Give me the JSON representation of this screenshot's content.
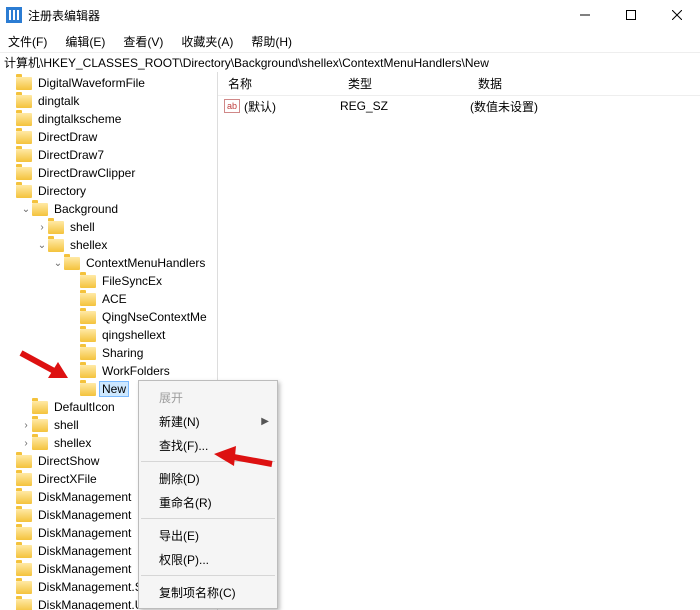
{
  "window": {
    "title": "注册表编辑器"
  },
  "menu": [
    "文件(F)",
    "编辑(E)",
    "查看(V)",
    "收藏夹(A)",
    "帮助(H)"
  ],
  "address": "计算机\\HKEY_CLASSES_ROOT\\Directory\\Background\\shellex\\ContextMenuHandlers\\New",
  "tree": [
    {
      "indent": 0,
      "chev": "",
      "label": "DigitalWaveformFile"
    },
    {
      "indent": 0,
      "chev": "",
      "label": "dingtalk"
    },
    {
      "indent": 0,
      "chev": "",
      "label": "dingtalkscheme"
    },
    {
      "indent": 0,
      "chev": "",
      "label": "DirectDraw"
    },
    {
      "indent": 0,
      "chev": "",
      "label": "DirectDraw7"
    },
    {
      "indent": 0,
      "chev": "",
      "label": "DirectDrawClipper"
    },
    {
      "indent": 0,
      "chev": "",
      "label": "Directory"
    },
    {
      "indent": 1,
      "chev": "open",
      "label": "Background"
    },
    {
      "indent": 2,
      "chev": "closed",
      "label": "shell"
    },
    {
      "indent": 2,
      "chev": "open",
      "label": "shellex"
    },
    {
      "indent": 3,
      "chev": "open",
      "label": "ContextMenuHandlers"
    },
    {
      "indent": 4,
      "chev": "",
      "label": "FileSyncEx"
    },
    {
      "indent": 4,
      "chev": "",
      "label": "ACE"
    },
    {
      "indent": 4,
      "chev": "",
      "label": "QingNseContextMe"
    },
    {
      "indent": 4,
      "chev": "",
      "label": "qingshellext"
    },
    {
      "indent": 4,
      "chev": "",
      "label": "Sharing"
    },
    {
      "indent": 4,
      "chev": "",
      "label": "WorkFolders"
    },
    {
      "indent": 4,
      "chev": "",
      "label": "New",
      "selected": true
    },
    {
      "indent": 1,
      "chev": "",
      "label": "DefaultIcon"
    },
    {
      "indent": 1,
      "chev": "closed",
      "label": "shell"
    },
    {
      "indent": 1,
      "chev": "closed",
      "label": "shellex"
    },
    {
      "indent": 0,
      "chev": "",
      "label": "DirectShow"
    },
    {
      "indent": 0,
      "chev": "",
      "label": "DirectXFile"
    },
    {
      "indent": 0,
      "chev": "",
      "label": "DiskManagement"
    },
    {
      "indent": 0,
      "chev": "",
      "label": "DiskManagement"
    },
    {
      "indent": 0,
      "chev": "",
      "label": "DiskManagement"
    },
    {
      "indent": 0,
      "chev": "",
      "label": "DiskManagement"
    },
    {
      "indent": 0,
      "chev": "",
      "label": "DiskManagement"
    },
    {
      "indent": 0,
      "chev": "",
      "label": "DiskManagement.SnapInExtens"
    },
    {
      "indent": 0,
      "chev": "",
      "label": "DiskManagement.UITasks"
    }
  ],
  "list": {
    "headers": {
      "name": "名称",
      "type": "类型",
      "data": "数据"
    },
    "rows": [
      {
        "name": "(默认)",
        "type": "REG_SZ",
        "data": "(数值未设置)"
      }
    ]
  },
  "ctx": {
    "expand": "展开",
    "new": "新建(N)",
    "find": "查找(F)...",
    "delete": "删除(D)",
    "rename": "重命名(R)",
    "export": "导出(E)",
    "perm": "权限(P)...",
    "copykey": "复制项名称(C)"
  }
}
